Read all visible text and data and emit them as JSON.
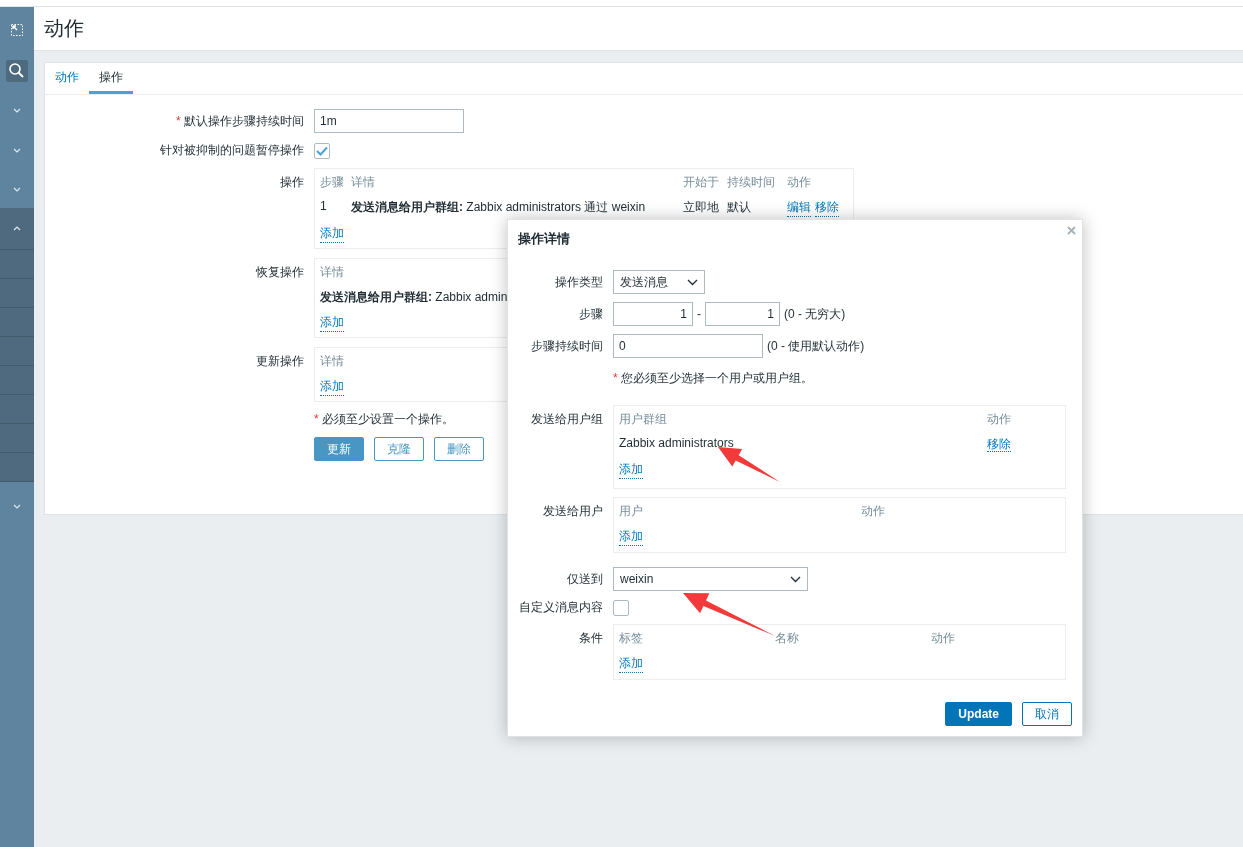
{
  "page_title": "动作",
  "tabs": [
    {
      "label": "动作",
      "selected": false
    },
    {
      "label": "操作",
      "selected": true
    }
  ],
  "form": {
    "default_step_duration": {
      "label": "默认操作步骤持续时间",
      "marker": "*",
      "value": "1m"
    },
    "pause_suppressed": {
      "label": "针对被抑制的问题暂停操作",
      "checked": true
    },
    "operations": {
      "label": "操作",
      "columns": [
        "步骤",
        "详情",
        "开始于",
        "持续时间",
        "动作"
      ],
      "rows": [
        {
          "step": "1",
          "details": "**发送消息给用户群组:** Zabbix administrators 通过 weixin",
          "start": "立即地",
          "duration": "默认",
          "actions": [
            "编辑",
            "移除"
          ]
        }
      ],
      "add": "添加"
    },
    "recovery_operations": {
      "label": "恢复操作",
      "columns": [
        "详情"
      ],
      "rows": [
        {
          "details": "**发送消息给用户群组:** Zabbix admin"
        }
      ],
      "add": "添加"
    },
    "update_operations": {
      "label": "更新操作",
      "columns": [
        "详情"
      ],
      "add": "添加"
    },
    "note": {
      "marker": "*",
      "text": "必须至少设置一个操作。"
    },
    "buttons": [
      {
        "label": "更新",
        "primary": true
      },
      {
        "label": "克隆",
        "primary": false
      },
      {
        "label": "删除",
        "primary": false
      }
    ]
  },
  "modal": {
    "title": "操作详情",
    "operation_type": {
      "label": "操作类型",
      "value": "发送消息"
    },
    "steps": {
      "label": "步骤",
      "from": "1",
      "separator": "-",
      "to": "1",
      "hint": "(0 - 无穷大)"
    },
    "step_duration": {
      "label": "步骤持续时间",
      "value": "0",
      "hint": "(0 - 使用默认动作)"
    },
    "note": {
      "marker": "*",
      "text": "您必须至少选择一个用户或用户组。"
    },
    "user_groups": {
      "label": "发送给用户组",
      "columns": [
        "用户群组",
        "动作"
      ],
      "rows": [
        {
          "name": "Zabbix administrators",
          "action": "移除"
        }
      ],
      "add": "添加"
    },
    "users": {
      "label": "发送给用户",
      "columns": [
        "用户",
        "动作"
      ],
      "add": "添加"
    },
    "send_only_to": {
      "label": "仅送到",
      "value": "weixin"
    },
    "custom_message": {
      "label": "自定义消息内容",
      "checked": false
    },
    "conditions": {
      "label": "条件",
      "columns": [
        "标签",
        "名称",
        "动作"
      ],
      "add": "添加"
    },
    "buttons": [
      {
        "label": "Update",
        "primary": true
      },
      {
        "label": "取消",
        "primary": false
      }
    ]
  }
}
